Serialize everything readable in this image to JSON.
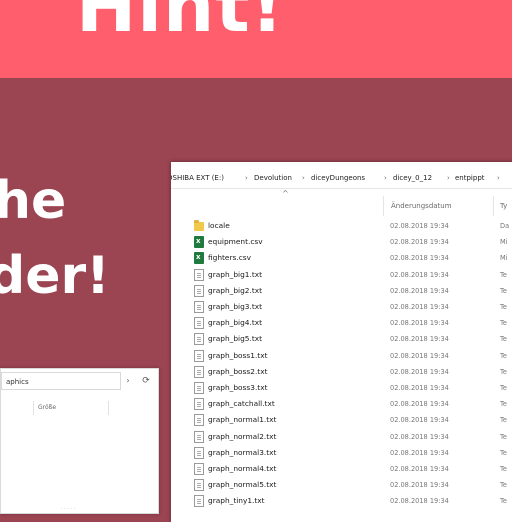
{
  "banner": {
    "title": "Hint!"
  },
  "overlay": {
    "line1": "he",
    "line2": "der!"
  },
  "left_window": {
    "address": "aphics",
    "chevron": "›",
    "refresh": "⟳",
    "column_header": "Größe",
    "footer": "· · · · ·"
  },
  "main_window": {
    "breadcrumbs": [
      "OSHIBA EXT (E:)",
      "Devolution",
      "diceyDungeons",
      "dicey_0_12",
      "entpippt"
    ],
    "separator": "›",
    "columns": {
      "name_sort": "^",
      "date": "Änderungsdatum",
      "type": "Ty"
    },
    "files": [
      {
        "name": "locale",
        "date": "02.08.2018 19:34",
        "type": "Da",
        "icon": "folder-icon"
      },
      {
        "name": "equipment.csv",
        "date": "02.08.2018 19:34",
        "type": "Mi",
        "icon": "csv-icon"
      },
      {
        "name": "fighters.csv",
        "date": "02.08.2018 19:34",
        "type": "Mi",
        "icon": "csv-icon"
      },
      {
        "name": "graph_big1.txt",
        "date": "02.08.2018 19:34",
        "type": "Te",
        "icon": "text-file-icon"
      },
      {
        "name": "graph_big2.txt",
        "date": "02.08.2018 19:34",
        "type": "Te",
        "icon": "text-file-icon"
      },
      {
        "name": "graph_big3.txt",
        "date": "02.08.2018 19:34",
        "type": "Te",
        "icon": "text-file-icon"
      },
      {
        "name": "graph_big4.txt",
        "date": "02.08.2018 19:34",
        "type": "Te",
        "icon": "text-file-icon"
      },
      {
        "name": "graph_big5.txt",
        "date": "02.08.2018 19:34",
        "type": "Te",
        "icon": "text-file-icon"
      },
      {
        "name": "graph_boss1.txt",
        "date": "02.08.2018 19:34",
        "type": "Te",
        "icon": "text-file-icon"
      },
      {
        "name": "graph_boss2.txt",
        "date": "02.08.2018 19:34",
        "type": "Te",
        "icon": "text-file-icon"
      },
      {
        "name": "graph_boss3.txt",
        "date": "02.08.2018 19:34",
        "type": "Te",
        "icon": "text-file-icon"
      },
      {
        "name": "graph_catchall.txt",
        "date": "02.08.2018 19:34",
        "type": "Te",
        "icon": "text-file-icon"
      },
      {
        "name": "graph_normal1.txt",
        "date": "02.08.2018 19:34",
        "type": "Te",
        "icon": "text-file-icon"
      },
      {
        "name": "graph_normal2.txt",
        "date": "02.08.2018 19:34",
        "type": "Te",
        "icon": "text-file-icon"
      },
      {
        "name": "graph_normal3.txt",
        "date": "02.08.2018 19:34",
        "type": "Te",
        "icon": "text-file-icon"
      },
      {
        "name": "graph_normal4.txt",
        "date": "02.08.2018 19:34",
        "type": "Te",
        "icon": "text-file-icon"
      },
      {
        "name": "graph_normal5.txt",
        "date": "02.08.2018 19:34",
        "type": "Te",
        "icon": "text-file-icon"
      },
      {
        "name": "graph_tiny1.txt",
        "date": "02.08.2018 19:34",
        "type": "Te",
        "icon": "text-file-icon"
      }
    ]
  }
}
